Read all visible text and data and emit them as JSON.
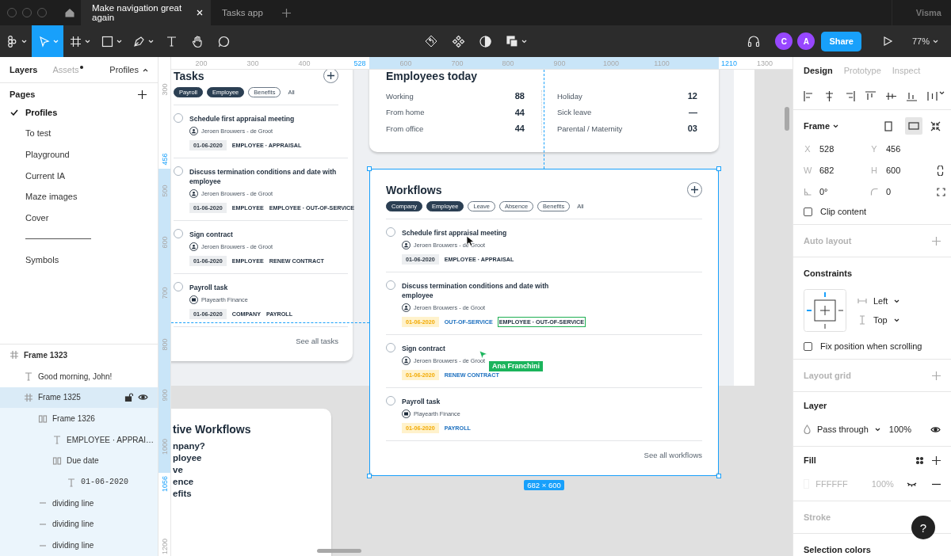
{
  "title_bar": {
    "tabs": [
      {
        "label": "Make navigation great again",
        "selected": true
      },
      {
        "label": "Tasks app",
        "selected": false
      }
    ],
    "team": "Visma"
  },
  "toolbar": {
    "tools": [
      {
        "kind": "main-menu",
        "selected": false,
        "menu": true
      },
      {
        "kind": "move",
        "selected": true,
        "menu": true
      },
      {
        "kind": "frame",
        "selected": false,
        "menu": true
      },
      {
        "kind": "shape",
        "selected": false,
        "menu": true
      },
      {
        "kind": "pen",
        "selected": false,
        "menu": true
      },
      {
        "kind": "text",
        "selected": false,
        "menu": false
      },
      {
        "kind": "hand",
        "selected": false,
        "menu": false
      },
      {
        "kind": "comment",
        "selected": false,
        "menu": false
      }
    ],
    "avatars": [
      {
        "initial": "C"
      },
      {
        "initial": "A"
      }
    ],
    "share": "Share",
    "zoom": "77%"
  },
  "left_panel": {
    "tabs": [
      {
        "label": "Layers",
        "selected": true,
        "badge": false
      },
      {
        "label": "Assets",
        "selected": false,
        "badge": true
      }
    ],
    "page_switch": "Profiles",
    "pages_title": "Pages",
    "pages": [
      {
        "kind": "page",
        "label": "Profiles",
        "selected": true
      },
      {
        "kind": "page",
        "label": "To test",
        "selected": false
      },
      {
        "kind": "page",
        "label": "Playground",
        "selected": false
      },
      {
        "kind": "page",
        "label": "Current IA",
        "selected": false
      },
      {
        "kind": "page",
        "label": "Maze images",
        "selected": false
      },
      {
        "kind": "page",
        "label": "Cover",
        "selected": false
      },
      {
        "kind": "separator",
        "selected": false
      },
      {
        "kind": "page",
        "label": "Symbols",
        "selected": false
      }
    ],
    "layers": [
      {
        "kind": "frame",
        "name": "Frame 1323",
        "selected": false,
        "children": [
          {
            "kind": "text",
            "name": "Good morning, John!",
            "selected": false
          },
          {
            "kind": "frame",
            "name": "Frame 1325",
            "selected": true,
            "children": [
              {
                "kind": "stack",
                "name": "Frame 1326",
                "selected": false,
                "children": [
                  {
                    "kind": "text",
                    "name": "EMPLOYEE · APPRAI…",
                    "selected": false
                  },
                  {
                    "kind": "stack",
                    "name": "Due date",
                    "selected": false,
                    "children": [
                      {
                        "kind": "text",
                        "name": "01-06-2020",
                        "selected": false
                      }
                    ]
                  }
                ]
              },
              {
                "kind": "line",
                "name": "dividing line",
                "selected": false
              },
              {
                "kind": "line",
                "name": "dividing line",
                "selected": false
              },
              {
                "kind": "line",
                "name": "dividing line",
                "selected": false
              }
            ]
          }
        ]
      }
    ]
  },
  "canvas": {
    "h_ruler": [
      {
        "label": "200",
        "selected": false
      },
      {
        "label": "300",
        "selected": false
      },
      {
        "label": "400",
        "selected": false
      },
      {
        "label": "528",
        "selected": true
      },
      {
        "label": "600",
        "selected": false
      },
      {
        "label": "700",
        "selected": false
      },
      {
        "label": "800",
        "selected": false
      },
      {
        "label": "900",
        "selected": false
      },
      {
        "label": "1000",
        "selected": false
      },
      {
        "label": "1100",
        "selected": false
      },
      {
        "label": "1210",
        "selected": true
      },
      {
        "label": "1300",
        "selected": false
      }
    ],
    "v_ruler": [
      {
        "label": "300",
        "selected": false
      },
      {
        "label": "456",
        "selected": true
      },
      {
        "label": "500",
        "selected": false
      },
      {
        "label": "600",
        "selected": false
      },
      {
        "label": "700",
        "selected": false
      },
      {
        "label": "800",
        "selected": false
      },
      {
        "label": "900",
        "selected": false
      },
      {
        "label": "1000",
        "selected": false
      },
      {
        "label": "1056",
        "selected": true
      },
      {
        "label": "1200",
        "selected": false
      }
    ],
    "tasks_card": {
      "title": "Tasks",
      "filters": [
        {
          "label": "Payroll",
          "selected": true,
          "kind": "chip"
        },
        {
          "label": "Employee",
          "selected": true,
          "kind": "chip"
        },
        {
          "label": "Benefits",
          "selected": false,
          "kind": "chip"
        },
        {
          "label": "All",
          "selected": false,
          "kind": "plain"
        }
      ],
      "tasks": [
        {
          "title": "Schedule first appraisal meeting",
          "checked": false,
          "assignee": {
            "kind": "person",
            "name": "Jeroen Brouwers - de Groot"
          },
          "date": {
            "text": "01-06-2020",
            "due_soon": false
          },
          "tags": [
            {
              "text": "EMPLOYEE · APPRAISAL",
              "accent": false,
              "hovered": false
            }
          ]
        },
        {
          "title": "Discuss termination conditions and date with employee",
          "checked": false,
          "assignee": {
            "kind": "person",
            "name": "Jeroen Brouwers - de Groot"
          },
          "date": {
            "text": "01-06-2020",
            "due_soon": false
          },
          "tags": [
            {
              "text": "EMPLOYEE",
              "accent": false,
              "hovered": false
            },
            {
              "text": "EMPLOYEE · OUT-OF-SERVICE",
              "accent": false,
              "hovered": false
            }
          ]
        },
        {
          "title": "Sign contract",
          "checked": false,
          "assignee": {
            "kind": "person",
            "name": "Jeroen Brouwers - de Groot"
          },
          "date": {
            "text": "01-06-2020",
            "due_soon": false
          },
          "tags": [
            {
              "text": "EMPLOYEE",
              "accent": false,
              "hovered": false
            },
            {
              "text": "RENEW CONTRACT",
              "accent": false,
              "hovered": false
            }
          ]
        },
        {
          "title": "Payroll task",
          "checked": false,
          "assignee": {
            "kind": "company",
            "name": "Playearth Finance"
          },
          "date": {
            "text": "01-06-2020",
            "due_soon": false
          },
          "tags": [
            {
              "text": "COMPANY",
              "accent": false,
              "hovered": false
            },
            {
              "text": "PAYROLL",
              "accent": false,
              "hovered": false
            }
          ]
        }
      ],
      "footer": "See all tasks"
    },
    "employees_card": {
      "title": "Employees today",
      "left": [
        {
          "label": "Working",
          "value": "88"
        },
        {
          "label": "From home",
          "value": "44"
        },
        {
          "label": "From office",
          "value": "44"
        }
      ],
      "right": [
        {
          "label": "Holiday",
          "value": "12"
        },
        {
          "label": "Sick leave",
          "value": "—"
        },
        {
          "label": "Parental / Maternity",
          "value": "03"
        }
      ]
    },
    "workflows_card": {
      "title": "Workflows",
      "filters": [
        {
          "label": "Company",
          "selected": true,
          "kind": "chip"
        },
        {
          "label": "Employee",
          "selected": true,
          "kind": "chip"
        },
        {
          "label": "Leave",
          "selected": false,
          "kind": "chip"
        },
        {
          "label": "Absence",
          "selected": false,
          "kind": "chip"
        },
        {
          "label": "Benefits",
          "selected": false,
          "kind": "chip"
        },
        {
          "label": "All",
          "selected": false,
          "kind": "plain"
        }
      ],
      "tasks": [
        {
          "title": "Schedule first appraisal meeting",
          "checked": false,
          "assignee": {
            "kind": "person",
            "name": "Jeroen Brouwers - de Groot"
          },
          "date": {
            "text": "01-06-2020",
            "due_soon": false
          },
          "tags": [
            {
              "text": "EMPLOYEE · APPRAISAL",
              "accent": false,
              "hovered": false
            }
          ]
        },
        {
          "title": "Discuss termination conditions and date with employee",
          "checked": false,
          "assignee": {
            "kind": "person",
            "name": "Jeroen Brouwers - de Groot"
          },
          "date": {
            "text": "01-06-2020",
            "due_soon": true
          },
          "tags": [
            {
              "text": "OUT-OF-SERVICE",
              "accent": true,
              "hovered": false
            },
            {
              "text": "EMPLOYEE · OUT-OF-SERVICE",
              "accent": false,
              "hovered": true
            }
          ]
        },
        {
          "title": "Sign contract",
          "checked": false,
          "assignee": {
            "kind": "person",
            "name": "Jeroen Brouwers - de Groot"
          },
          "date": {
            "text": "01-06-2020",
            "due_soon": true
          },
          "tags": [
            {
              "text": "RENEW CONTRACT",
              "accent": true,
              "hovered": false
            }
          ]
        },
        {
          "title": "Payroll task",
          "checked": false,
          "assignee": {
            "kind": "company",
            "name": "Playearth Finance"
          },
          "date": {
            "text": "01-06-2020",
            "due_soon": true
          },
          "tags": [
            {
              "text": "PAYROLL",
              "accent": true,
              "hovered": false
            }
          ]
        }
      ],
      "footer": "See all workflows"
    },
    "active_card": {
      "title": "tive Workflows",
      "items": [
        "npany?",
        "ployee",
        "ve",
        "ence",
        "efits"
      ]
    },
    "selection": {
      "size": "682 × 600"
    },
    "collaborator": {
      "name": "Ana Franchini"
    }
  },
  "design_panel": {
    "tabs": [
      {
        "label": "Design",
        "selected": true
      },
      {
        "label": "Prototype",
        "selected": false
      },
      {
        "label": "Inspect",
        "selected": false
      }
    ],
    "frame": {
      "title": "Frame",
      "landscape": true,
      "fields": [
        {
          "kind": "letter",
          "label": "X",
          "value": "528"
        },
        {
          "kind": "letter",
          "label": "Y",
          "value": "456"
        },
        {
          "kind": "letter",
          "label": "W",
          "value": "682"
        },
        {
          "kind": "letter",
          "label": "H",
          "value": "600"
        },
        {
          "kind": "rotation",
          "value": "0°"
        },
        {
          "kind": "radius",
          "value": "0"
        }
      ],
      "clip": {
        "label": "Clip content",
        "checked": false
      }
    },
    "auto_layout": "Auto layout",
    "constraints": {
      "title": "Constraints",
      "horizontal": "Left",
      "vertical": "Top",
      "fix": {
        "label": "Fix position when scrolling",
        "checked": false
      }
    },
    "layout_grid": "Layout grid",
    "layer": {
      "title": "Layer",
      "blend": "Pass through",
      "opacity": "100%",
      "visible": true
    },
    "fill": {
      "title": "Fill",
      "color": "FFFFFF",
      "opacity": "100%",
      "visible": false
    },
    "stroke": "Stroke",
    "selection_colors": "Selection colors",
    "help": "?"
  }
}
